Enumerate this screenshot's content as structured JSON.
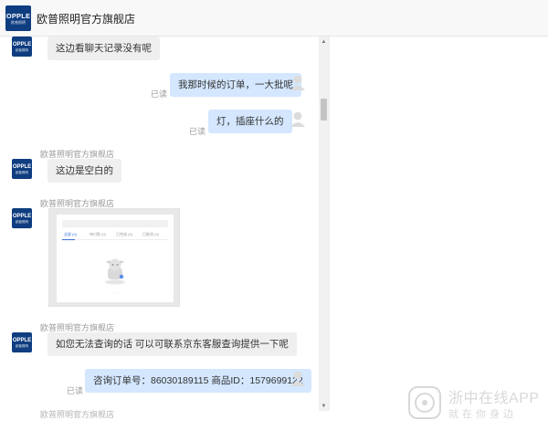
{
  "header": {
    "shop_title": "欧普照明官方旗舰店",
    "logo_brand": "OPPLE",
    "logo_sub": "欧普照明"
  },
  "messages": {
    "m1": {
      "text": "这边看聊天记录没有呢"
    },
    "m2": {
      "text": "我那时候的订单，一大批呢",
      "status": "已读"
    },
    "m3": {
      "text": "灯，插座什么的",
      "status": "已读"
    },
    "m4": {
      "sender": "欧普照明官方旗舰店",
      "text": "这边是空白的"
    },
    "m5": {
      "sender": "欧普照明官方旗舰店",
      "image_tabs": [
        "全部 (0)",
        "待付款 (0)",
        "已完成 (0)",
        "已取消 (0)"
      ]
    },
    "m6": {
      "sender": "欧普照明官方旗舰店",
      "text": "如您无法查询的话 可以可联系京东客服查询提供一下呢"
    },
    "m7": {
      "text": "咨询订单号：86030189115 商品ID：1579699122",
      "status": "已读"
    },
    "m8": {
      "sender": "欧普照明官方旗舰店"
    }
  },
  "scrollbar": {
    "up_arrow": "▲",
    "down_arrow": "▼"
  },
  "watermark": {
    "title": "浙中在线APP",
    "subtitle": "就在你身边"
  },
  "colors": {
    "brand_blue": "#0e3d80",
    "user_bubble": "#d4e7ff",
    "shop_bubble": "#efefef"
  }
}
